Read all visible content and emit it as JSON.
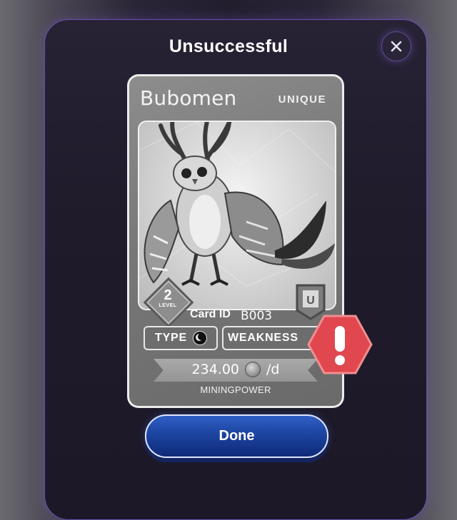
{
  "dialog": {
    "title": "Unsuccessful",
    "close_icon": "close-icon",
    "done_label": "Done"
  },
  "card": {
    "name": "Bubomen",
    "rarity": "UNIQUE",
    "level": "2",
    "level_label": "LEVEL",
    "rarity_letter": "U",
    "card_id_label": "Card ID",
    "card_id": "B003",
    "type_label": "TYPE",
    "type_icon": "moon-icon",
    "weakness_label": "WEAKNESS",
    "mining_power": "234.00",
    "power_unit": "/d",
    "power_label": "MININGPOWER"
  },
  "status": {
    "icon": "alert-icon",
    "color": "#e0474f"
  },
  "colors": {
    "accent_border": "#6a4fb0",
    "done_button": "#1c44a1"
  }
}
